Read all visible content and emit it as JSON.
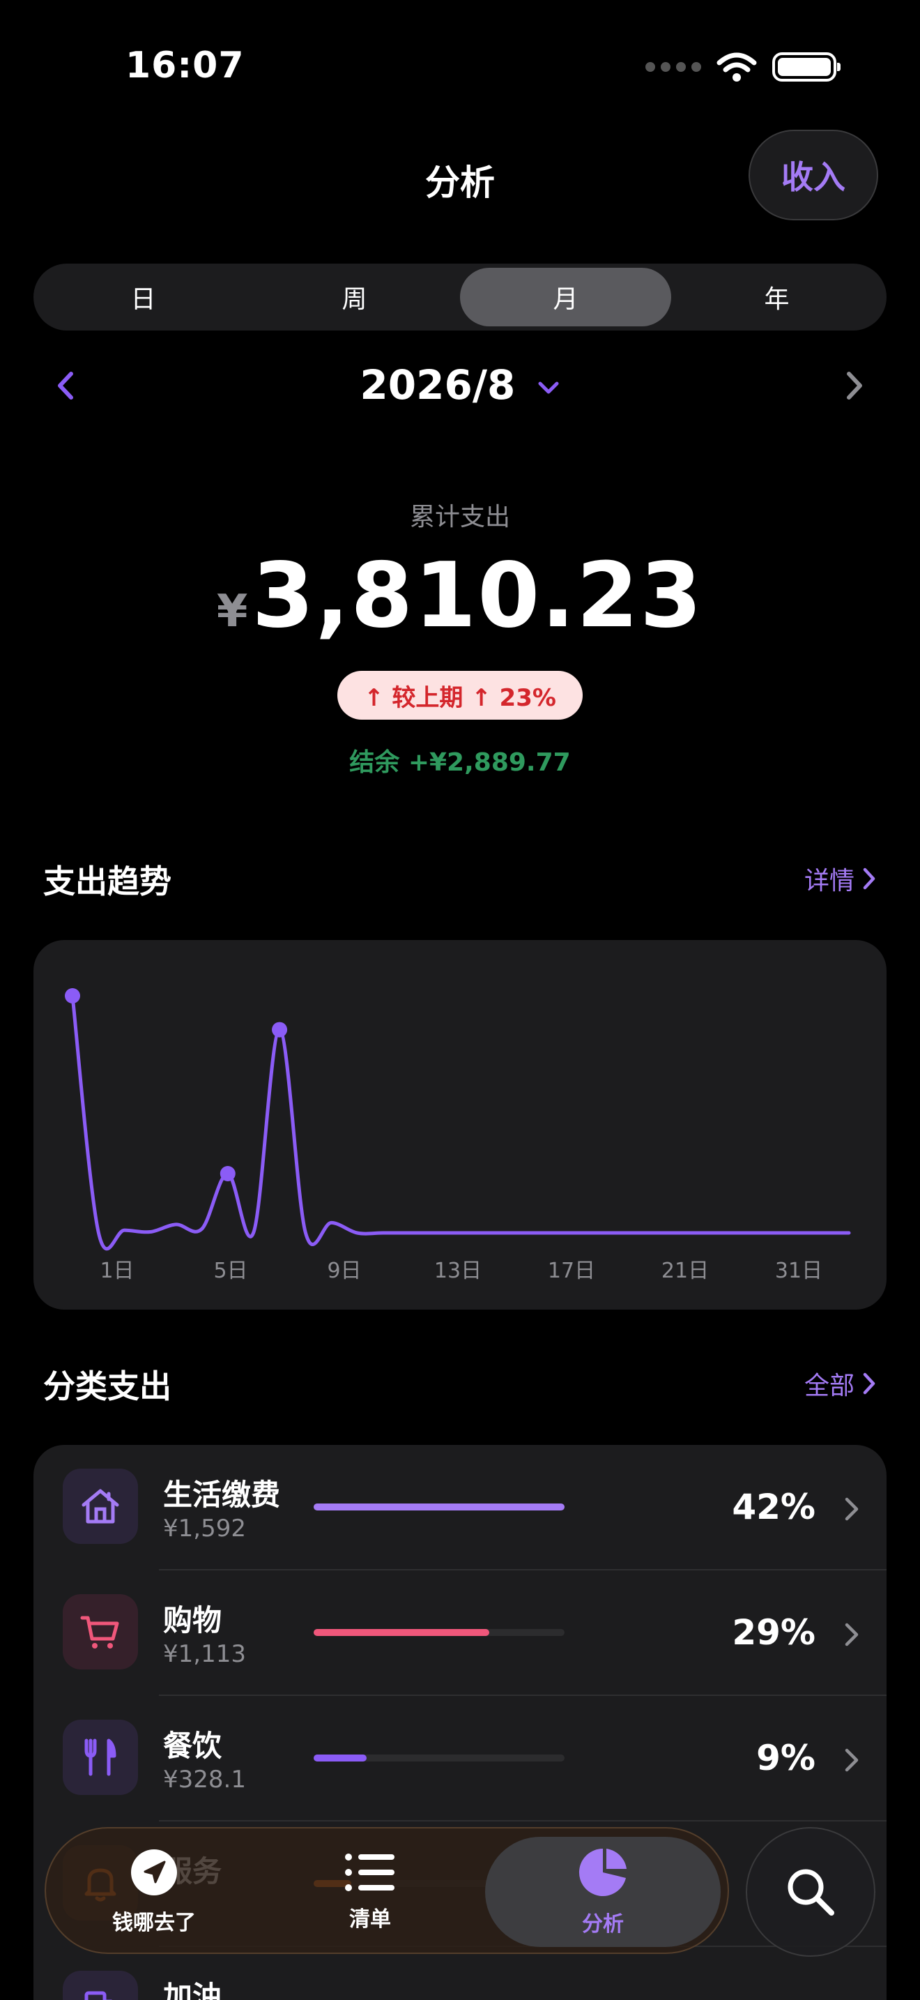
{
  "status_bar": {
    "time": "16:07"
  },
  "header": {
    "title": "分析",
    "income_button": "收入"
  },
  "period_tabs": [
    {
      "label": "日",
      "active": false
    },
    {
      "label": "周",
      "active": false
    },
    {
      "label": "月",
      "active": true
    },
    {
      "label": "年",
      "active": false
    }
  ],
  "date_nav": {
    "label": "2026/8"
  },
  "summary": {
    "caption": "累计支出",
    "currency": "¥",
    "amount": "3,810.23",
    "compare": "↑ 较上期 ↑ 23%",
    "balance": "结余 +¥2,889.77"
  },
  "trend_section": {
    "title": "支出趋势",
    "link": "详情"
  },
  "chart_data": {
    "type": "line",
    "x_tick_labels": [
      "1日",
      "5日",
      "9日",
      "13日",
      "17日",
      "21日",
      "31日"
    ],
    "x": [
      1,
      2,
      3,
      4,
      5,
      6,
      7,
      8,
      9,
      10,
      11,
      12,
      13,
      14,
      15,
      16,
      17,
      18,
      19,
      20,
      21,
      22,
      23,
      24,
      25,
      26,
      27,
      28,
      29,
      30,
      31
    ],
    "series": [
      {
        "values": [
          700,
          3,
          8,
          3,
          25,
          12,
          175,
          2,
          600,
          2,
          30,
          0,
          0,
          0,
          0,
          0,
          0,
          0,
          0,
          0,
          0,
          0,
          0,
          0,
          0,
          0,
          0,
          0,
          0,
          0,
          0
        ]
      }
    ],
    "highlighted_points": [
      1,
      7,
      9
    ],
    "color": "#8b5cf6",
    "grid": false
  },
  "category_section": {
    "title": "分类支出",
    "link": "全部"
  },
  "categories": [
    {
      "name": "生活缴费",
      "amount": "¥1,592",
      "percent": "42%",
      "share": 1.0,
      "color": "#a47bf5",
      "icon": "house-icon",
      "icon_bg": "#2a2438"
    },
    {
      "name": "购物",
      "amount": "¥1,113",
      "percent": "29%",
      "share": 0.7,
      "color": "#f0577b",
      "icon": "cart-icon",
      "icon_bg": "#35202a"
    },
    {
      "name": "餐饮",
      "amount": "¥328.1",
      "percent": "9%",
      "share": 0.21,
      "color": "#8b5cf6",
      "icon": "fork-knife-icon",
      "icon_bg": "#2a2438"
    },
    {
      "name": "服务",
      "amount": "",
      "percent": "",
      "share": 0.15,
      "color": "#f97316",
      "icon": "bell-icon",
      "icon_bg": "#3a2a20"
    },
    {
      "name": "加油",
      "amount": "",
      "percent": "",
      "share": 0.0,
      "color": "#8b5cf6",
      "icon": "fuel-icon",
      "icon_bg": "#2a2438"
    }
  ],
  "tab_bar": {
    "items": [
      {
        "label": "钱哪去了",
        "icon": "navigation-arrow-icon",
        "active": false
      },
      {
        "label": "清单",
        "icon": "list-icon",
        "active": false
      },
      {
        "label": "分析",
        "icon": "pie-chart-icon",
        "active": true
      }
    ],
    "search_icon": "search-icon"
  }
}
